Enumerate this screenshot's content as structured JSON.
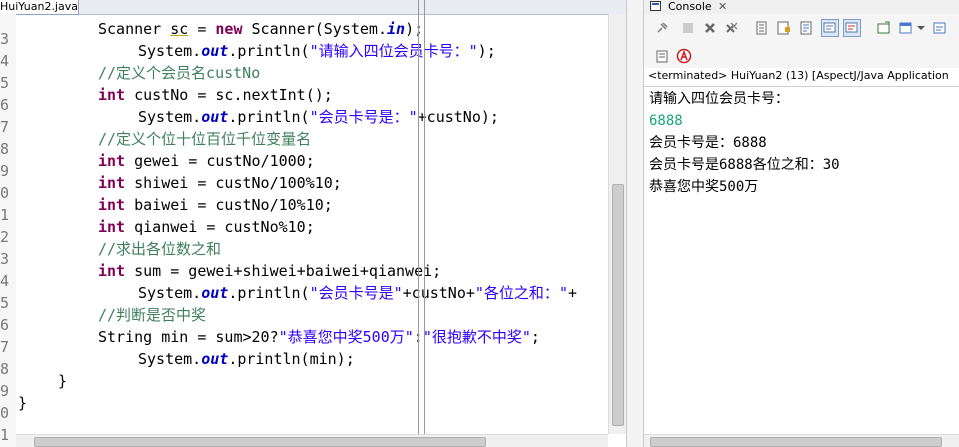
{
  "editor": {
    "tab_label": "HuiYuan2.java",
    "tab_close": "✕",
    "lines": [
      {
        "no": "3"
      },
      {
        "no": "4"
      },
      {
        "no": "5"
      },
      {
        "no": "6"
      },
      {
        "no": "7"
      },
      {
        "no": "8"
      },
      {
        "no": "9"
      },
      {
        "no": "0"
      },
      {
        "no": "1"
      },
      {
        "no": "2"
      },
      {
        "no": "3"
      },
      {
        "no": "4"
      },
      {
        "no": "5"
      },
      {
        "no": "6"
      },
      {
        "no": "7"
      },
      {
        "no": "8"
      },
      {
        "no": "9"
      },
      {
        "no": "0"
      },
      {
        "no": "1"
      }
    ],
    "code": {
      "l1": {
        "t1": "Scanner ",
        "t2": "sc",
        "t3": " = ",
        "t4": "new",
        "t5": " Scanner(System.",
        "t6": "in",
        "t7": ");"
      },
      "l2": {
        "t1": "System.",
        "t2": "out",
        "t3": ".println(",
        "t4": "\"请输入四位会员卡号：\"",
        "t5": ");"
      },
      "l3": {
        "t1": "//定义个会员名custNo"
      },
      "l4": {
        "t1": "int",
        "t2": " custNo = sc.nextInt();"
      },
      "l5": {
        "t1": "System.",
        "t2": "out",
        "t3": ".println(",
        "t4": "\"会员卡号是：\"",
        "t5": "+custNo);"
      },
      "l6": {
        "t1": "//定义个位十位百位千位变量名"
      },
      "l7": {
        "t1": "int",
        "t2": " gewei = custNo/1000;"
      },
      "l8": {
        "t1": "int",
        "t2": " shiwei = custNo/100%10;"
      },
      "l9": {
        "t1": "int",
        "t2": " baiwei = custNo/10%10;"
      },
      "l10": {
        "t1": "int",
        "t2": " qianwei = custNo%10;"
      },
      "l11": {
        "t1": "//求出各位数之和"
      },
      "l12": {
        "t1": "int",
        "t2": " sum = gewei+shiwei+baiwei+qianwei;"
      },
      "l13": {
        "t1": "System.",
        "t2": "out",
        "t3": ".println(",
        "t4": "\"会员卡号是\"",
        "t5": "+custNo+",
        "t6": "\"各位之和：\"",
        "t7": "+"
      },
      "l14": {
        "t1": "//判断是否中奖"
      },
      "l15": {
        "t1": "String min = sum>20?",
        "t2": "\"恭喜您中奖500万\"",
        "t3": ":",
        "t4": "\"很抱歉不中奖\"",
        "t5": ";"
      },
      "l16": {
        "t1": "System.",
        "t2": "out",
        "t3": ".println(min);"
      },
      "l17": {
        "t1": "}"
      },
      "l18": {
        "t1": "}"
      }
    }
  },
  "console": {
    "tab_label": "Console",
    "tab_close": "✕",
    "status": "<terminated> HuiYuan2 (13) [AspectJ/Java Application",
    "output": [
      {
        "text": "请输入四位会员卡号：",
        "kind": "stdout"
      },
      {
        "text": "6888",
        "kind": "stdin"
      },
      {
        "text": "会员卡号是：6888",
        "kind": "stdout"
      },
      {
        "text": "会员卡号是6888各位之和：30",
        "kind": "stdout"
      },
      {
        "text": "恭喜您中奖500万",
        "kind": "stdout"
      }
    ],
    "colors": {
      "stdin": "#15a877",
      "keyword": "#7f0055",
      "string": "#2a00ff",
      "comment": "#3f7f5f"
    },
    "toolbar_icons": [
      "pin-icon",
      "remove-launch-icon",
      "terminate-icon",
      "remove-all-icon",
      "scroll-lock-icon",
      "word-wrap-icon",
      "show-stdout-icon",
      "show-stderr-icon",
      "open-console-icon",
      "display-console-icon",
      "new-console-icon"
    ]
  }
}
